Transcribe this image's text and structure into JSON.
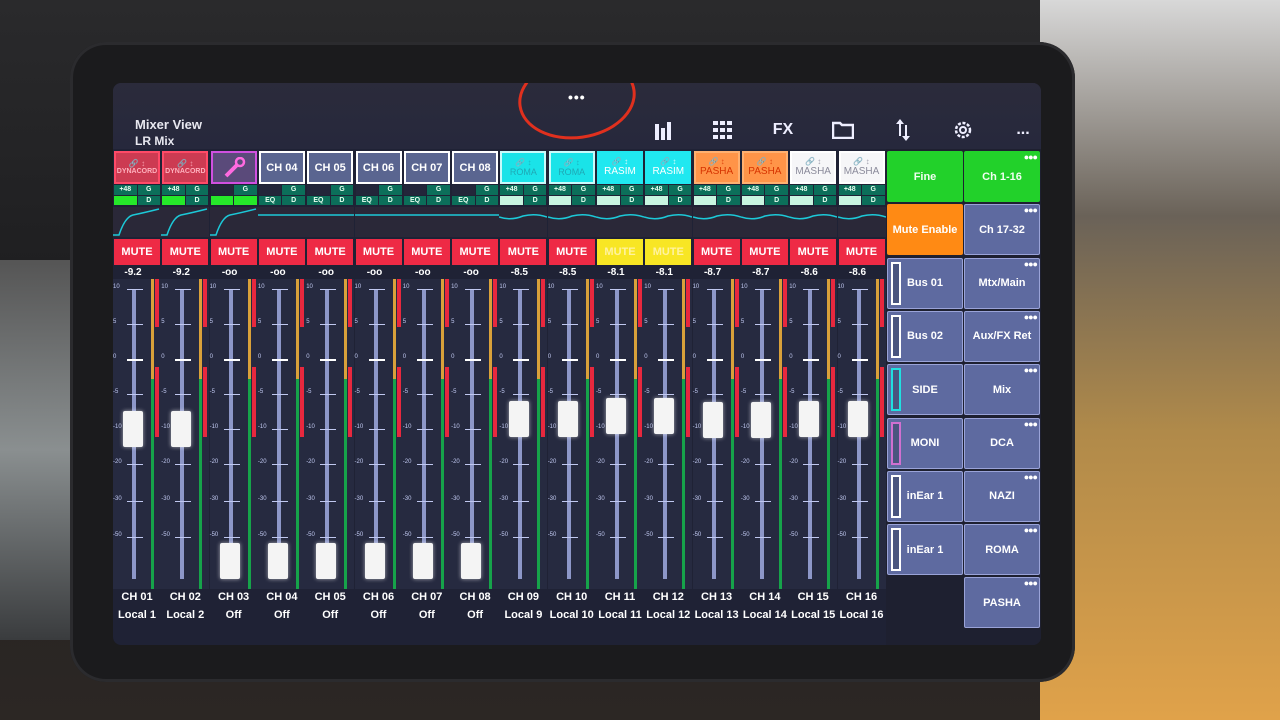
{
  "header": {
    "title": "Mixer View",
    "subtitle": "LR Mix",
    "top_handle": "•••"
  },
  "toolbar": [
    {
      "name": "meters",
      "icon": "bar-chart-icon",
      "label": ""
    },
    {
      "name": "grid",
      "icon": "grid-icon",
      "label": ""
    },
    {
      "name": "fx",
      "icon": "fx-icon",
      "label": "FX"
    },
    {
      "name": "files",
      "icon": "folder-icon",
      "label": ""
    },
    {
      "name": "routing",
      "icon": "swap-arrows-icon",
      "label": ""
    },
    {
      "name": "settings",
      "icon": "gear-icon",
      "label": ""
    },
    {
      "name": "more",
      "icon": "more-icon",
      "label": "..."
    }
  ],
  "channels": [
    {
      "tile": "DYNACORD",
      "style": "red",
      "gain": "+48",
      "db": "-9.2",
      "mute": "MUTE",
      "mute_active": "red",
      "fader_db": -10,
      "ch": "CH 01",
      "source": "Local 1"
    },
    {
      "tile": "DYNACORD",
      "style": "red",
      "gain": "+48",
      "db": "-9.2",
      "mute": "MUTE",
      "mute_active": "red",
      "fader_db": -10,
      "ch": "CH 02",
      "source": "Local 2"
    },
    {
      "tile": "",
      "style": "pink",
      "gain": "",
      "db": "-oo",
      "mute": "MUTE",
      "mute_active": "red",
      "fader_db": -70,
      "ch": "CH 03",
      "source": "Off"
    },
    {
      "tile": "CH 04",
      "style": "blue",
      "gain": "",
      "db": "-oo",
      "mute": "MUTE",
      "mute_active": "red",
      "fader_db": -70,
      "ch": "CH 04",
      "source": "Off"
    },
    {
      "tile": "CH 05",
      "style": "blue",
      "gain": "",
      "db": "-oo",
      "mute": "MUTE",
      "mute_active": "red",
      "fader_db": -70,
      "ch": "CH 05",
      "source": "Off"
    },
    {
      "tile": "CH 06",
      "style": "blue",
      "gain": "",
      "db": "-oo",
      "mute": "MUTE",
      "mute_active": "red",
      "fader_db": -70,
      "ch": "CH 06",
      "source": "Off"
    },
    {
      "tile": "CH 07",
      "style": "blue",
      "gain": "",
      "db": "-oo",
      "mute": "MUTE",
      "mute_active": "red",
      "fader_db": -70,
      "ch": "CH 07",
      "source": "Off"
    },
    {
      "tile": "CH 08",
      "style": "blue",
      "gain": "",
      "db": "-oo",
      "mute": "MUTE",
      "mute_active": "red",
      "fader_db": -70,
      "ch": "CH 08",
      "source": "Off"
    },
    {
      "tile": "ROMA",
      "style": "aqua",
      "gain": "+48",
      "db": "-8.5",
      "mute": "MUTE",
      "mute_active": "red",
      "fader_db": -8.5,
      "ch": "CH 09",
      "source": "Local 9"
    },
    {
      "tile": "ROMA",
      "style": "aqua",
      "gain": "+48",
      "db": "-8.5",
      "mute": "MUTE",
      "mute_active": "red",
      "fader_db": -8.5,
      "ch": "CH 10",
      "source": "Local 10"
    },
    {
      "tile": "RASIM",
      "style": "aqua2",
      "gain": "+48",
      "db": "-8.1",
      "mute": "MUTE",
      "mute_active": "yellow",
      "fader_db": -8.1,
      "ch": "CH 11",
      "source": "Local 11"
    },
    {
      "tile": "RASIM",
      "style": "aqua2",
      "gain": "+48",
      "db": "-8.1",
      "mute": "MUTE",
      "mute_active": "yellow",
      "fader_db": -8.1,
      "ch": "CH 12",
      "source": "Local 12"
    },
    {
      "tile": "PASHA",
      "style": "orange",
      "gain": "+48",
      "db": "-8.7",
      "mute": "MUTE",
      "mute_active": "red",
      "fader_db": -8.7,
      "ch": "CH 13",
      "source": "Local 13"
    },
    {
      "tile": "PASHA",
      "style": "orange",
      "gain": "+48",
      "db": "-8.7",
      "mute": "MUTE",
      "mute_active": "red",
      "fader_db": -8.7,
      "ch": "CH 14",
      "source": "Local 14"
    },
    {
      "tile": "MASHA",
      "style": "white",
      "gain": "+48",
      "db": "-8.6",
      "mute": "MUTE",
      "mute_active": "red",
      "fader_db": -8.6,
      "ch": "CH 15",
      "source": "Local 15"
    },
    {
      "tile": "MASHA",
      "style": "white",
      "gain": "+48",
      "db": "-8.6",
      "mute": "MUTE",
      "mute_active": "red",
      "fader_db": -8.6,
      "ch": "CH 16",
      "source": "Local 16"
    }
  ],
  "strip_labels": {
    "gate": "G",
    "dyn": "D",
    "eq": "EQ"
  },
  "fader_scale": [
    "10",
    "5",
    "0",
    "-5",
    "-10",
    "-20",
    "-30",
    "-50"
  ],
  "side_left": [
    {
      "label": "Fine",
      "style": "green"
    },
    {
      "label": "Mute Enable",
      "style": "orange"
    },
    {
      "label": "Bus 01",
      "style": "bus",
      "marker": "#ffffff"
    },
    {
      "label": "Bus 02",
      "style": "bus",
      "marker": "#ffffff"
    },
    {
      "label": "SIDE",
      "style": "bus",
      "marker": "#20e0e0"
    },
    {
      "label": "MONI",
      "style": "bus",
      "marker": "#d070d0"
    },
    {
      "label": "inEar 1",
      "style": "bus",
      "marker": "#ffffff"
    },
    {
      "label": "inEar 1",
      "style": "bus",
      "marker": "#ffffff"
    }
  ],
  "side_right": [
    {
      "label": "Ch 1-16",
      "style": "green"
    },
    {
      "label": "Ch 17-32",
      "style": "bank"
    },
    {
      "label": "Mtx/Main",
      "style": "bank"
    },
    {
      "label": "Aux/FX Ret",
      "style": "bank"
    },
    {
      "label": "Mix",
      "style": "bank"
    },
    {
      "label": "DCA",
      "style": "bank"
    },
    {
      "label": "NAZI",
      "style": "bank"
    },
    {
      "label": "ROMA",
      "style": "bank"
    },
    {
      "label": "PASHA",
      "style": "bank"
    }
  ],
  "colors": {
    "mute_red": "#ee2a45",
    "mute_yellow": "#f8e624",
    "green_active": "#22d12a",
    "orange_active": "#ff8a14",
    "panel_blue": "#5e6aa0"
  }
}
